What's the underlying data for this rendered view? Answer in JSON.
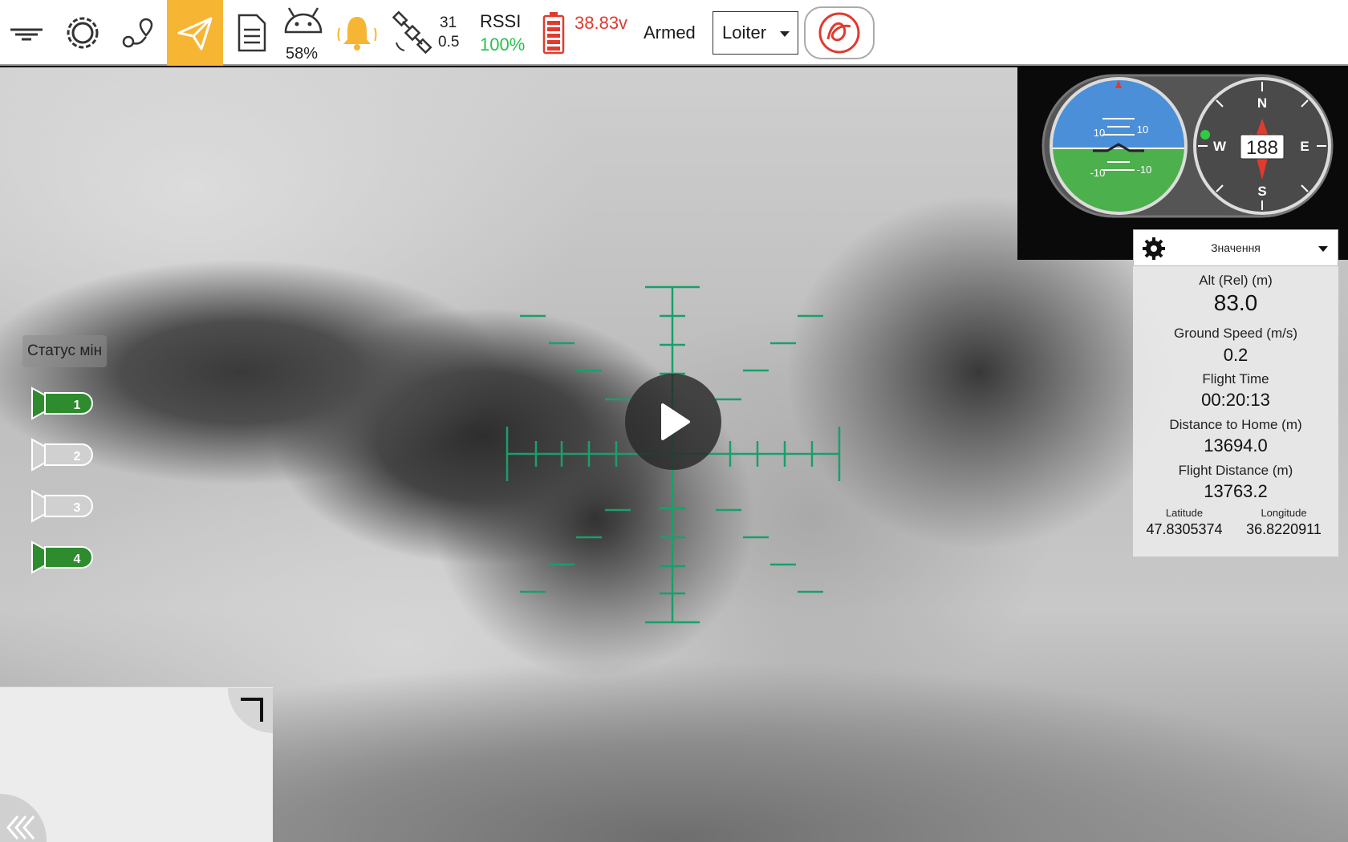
{
  "toolbar": {
    "menu_icon": "drone-menu-icon",
    "settings_icon": "gear-icon",
    "plan_icon": "route-plan-icon",
    "fly_icon": "paper-plane-icon",
    "analyze_icon": "document-icon",
    "device_battery": "58%",
    "satellites_count": "31",
    "hdop": "0.5",
    "rssi_label": "RSSI",
    "rssi_value": "100%",
    "battery_voltage": "38.83v",
    "armed_status": "Armed",
    "flight_mode": "Loiter",
    "accent_color": "#f6b634",
    "alert_color": "#e23a2e",
    "rssi_color": "#27c24c"
  },
  "mines": {
    "label": "Статус мін",
    "items": [
      {
        "number": "1",
        "status": "loaded",
        "color": "#2e8b2e"
      },
      {
        "number": "2",
        "status": "released",
        "color": "#d0d0d0"
      },
      {
        "number": "3",
        "status": "released",
        "color": "#d0d0d0"
      },
      {
        "number": "4",
        "status": "loaded",
        "color": "#2e8b2e"
      }
    ]
  },
  "instruments": {
    "attitude_ticks": [
      "10",
      "10",
      "-10",
      "-10"
    ],
    "compass": {
      "heading": "188",
      "n": "N",
      "e": "E",
      "s": "S",
      "w": "W"
    }
  },
  "values_panel": {
    "title": "Значення",
    "alt_label": "Alt (Rel) (m)",
    "alt_value": "83.0",
    "ground_speed_label": "Ground Speed (m/s)",
    "ground_speed_value": "0.2",
    "flight_time_label": "Flight Time",
    "flight_time_value": "00:20:13",
    "distance_home_label": "Distance to Home (m)",
    "distance_home_value": "13694.0",
    "flight_distance_label": "Flight Distance (m)",
    "flight_distance_value": "13763.2",
    "latitude_label": "Latitude",
    "latitude_value": "47.8305374",
    "longitude_label": "Longitude",
    "longitude_value": "36.8220911"
  },
  "reticle_color": "#18a06a"
}
